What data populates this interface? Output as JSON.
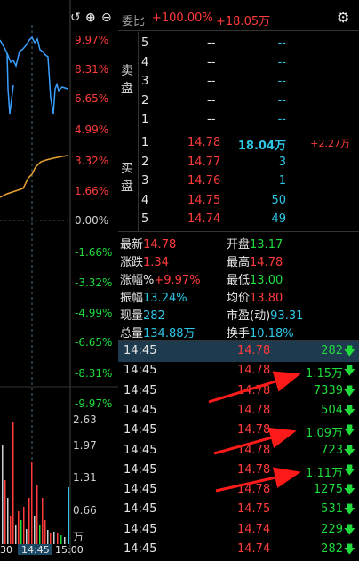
{
  "toolbar": {
    "icons": [
      "undo-icon",
      "add-icon",
      "minus-icon"
    ]
  },
  "chart": {
    "pct_labels_top": [
      "9.97%",
      "8.31%",
      "6.65%",
      "4.99%",
      "3.32%",
      "1.66%",
      "0.00%"
    ],
    "pct_labels_bottom": [
      "-1.66%",
      "-3.32%",
      "-4.99%",
      "-6.65%",
      "-8.31%",
      "-9.97%"
    ],
    "volume_labels": [
      "2.63",
      "1.97",
      "1.31",
      "0.66",
      "万"
    ],
    "time_labels": [
      "30",
      "14:45",
      "15:00"
    ]
  },
  "header": {
    "ratio_label": "委比",
    "ratio_value": "+100.00%",
    "diff_value": "+18.05万"
  },
  "order_book": {
    "sell_label": [
      "卖",
      "盘"
    ],
    "buy_label": [
      "买",
      "盘"
    ],
    "sell": [
      {
        "level": "5",
        "price": "--",
        "volume": "--"
      },
      {
        "level": "4",
        "price": "--",
        "volume": "--"
      },
      {
        "level": "3",
        "price": "--",
        "volume": "--"
      },
      {
        "level": "2",
        "price": "--",
        "volume": "--"
      },
      {
        "level": "1",
        "price": "--",
        "volume": "--"
      }
    ],
    "buy": [
      {
        "level": "1",
        "price": "14.78",
        "volume": "18.04万",
        "change": "+2.27万"
      },
      {
        "level": "2",
        "price": "14.77",
        "volume": "3",
        "change": ""
      },
      {
        "level": "3",
        "price": "14.76",
        "volume": "1",
        "change": ""
      },
      {
        "level": "4",
        "price": "14.75",
        "volume": "50",
        "change": ""
      },
      {
        "level": "5",
        "price": "14.74",
        "volume": "49",
        "change": ""
      }
    ]
  },
  "stats": {
    "latest_label": "最新",
    "latest": "14.78",
    "open_label": "开盘",
    "open": "13.17",
    "change_label": "涨跌",
    "change": "1.34",
    "high_label": "最高",
    "high": "14.78",
    "change_pct_label": "涨幅%",
    "change_pct": "+9.97%",
    "low_label": "最低",
    "low": "13.00",
    "amplitude_label": "振幅",
    "amplitude": "13.24%",
    "avg_label": "均价",
    "avg": "13.80",
    "current_vol_label": "现量",
    "current_vol": "282",
    "pe_label": "市盈(动)",
    "pe": "93.31",
    "total_vol_label": "总量",
    "total_vol": "134.88万",
    "turnover_label": "换手",
    "turnover": "10.18%"
  },
  "ticks": [
    {
      "time": "14:45",
      "price": "14.78",
      "volume": "282"
    },
    {
      "time": "14:45",
      "price": "14.78",
      "volume": "1.15万"
    },
    {
      "time": "14:45",
      "price": "14.78",
      "volume": "7339"
    },
    {
      "time": "14:45",
      "price": "14.78",
      "volume": "504"
    },
    {
      "time": "14:45",
      "price": "14.78",
      "volume": "1.09万"
    },
    {
      "time": "14:45",
      "price": "14.78",
      "volume": "723"
    },
    {
      "time": "14:45",
      "price": "14.78",
      "volume": "1.11万"
    },
    {
      "time": "14:45",
      "price": "14.78",
      "volume": "1275"
    },
    {
      "time": "14:45",
      "price": "14.75",
      "volume": "531"
    },
    {
      "time": "14:45",
      "price": "14.74",
      "volume": "229"
    },
    {
      "time": "14:45",
      "price": "14.74",
      "volume": "282"
    }
  ],
  "colors": {
    "up": "#ff3b3b",
    "down": "#1fdc3c",
    "accent": "#2ec7e6",
    "annotation": "#ff1a1a"
  }
}
